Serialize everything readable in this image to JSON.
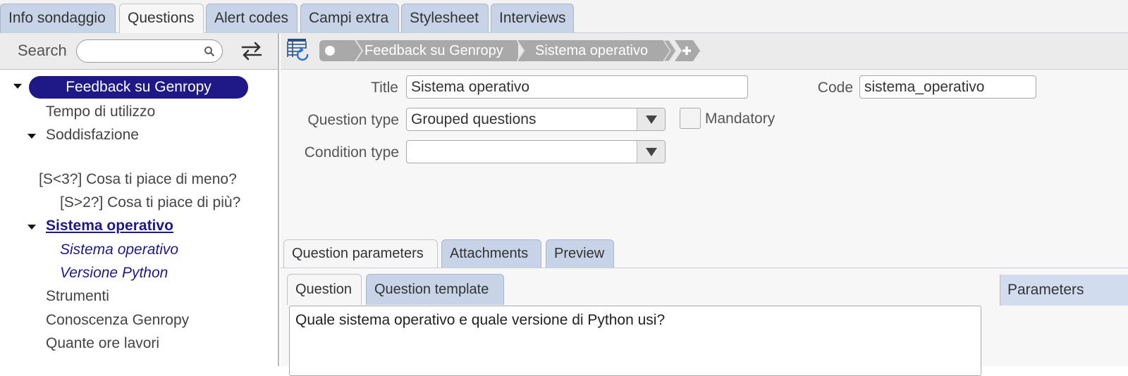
{
  "top_tabs": [
    "Info sondaggio",
    "Questions",
    "Alert codes",
    "Campi extra",
    "Stylesheet",
    "Interviews"
  ],
  "search": {
    "label": "Search",
    "value": ""
  },
  "tree": {
    "root": "Feedback su Genropy",
    "items": {
      "tempo": "Tempo di utilizzo",
      "soddisfazione": "Soddisfazione",
      "meno": "[S<3?] Cosa ti piace di meno?",
      "piu": "[S>2?] Cosa ti piace di più?",
      "sistema": "Sistema operativo",
      "sistema_child": "Sistema operativo",
      "python": "Versione Python",
      "strumenti": "Strumenti",
      "conoscenza": "Conoscenza Genropy",
      "ore": "Quante ore lavori"
    }
  },
  "breadcrumb": [
    "Feedback su Genropy",
    "Sistema operativo"
  ],
  "form": {
    "title_label": "Title",
    "title_value": "Sistema operativo",
    "code_label": "Code",
    "code_value": "sistema_operativo",
    "qtype_label": "Question type",
    "qtype_value": "Grouped questions",
    "mandatory_label": "Mandatory",
    "mandatory_checked": false,
    "ctype_label": "Condition type",
    "ctype_value": ""
  },
  "param_tabs": [
    "Question parameters",
    "Attachments",
    "Preview"
  ],
  "sub_tabs": [
    "Question",
    "Question template"
  ],
  "question_text": "Quale sistema operativo e quale versione di Python usi?",
  "params_header": "Parameters",
  "colors": {
    "accent": "#1f1987",
    "tab_inactive": "#c7d3e6",
    "crumb": "#a9a9a9"
  }
}
